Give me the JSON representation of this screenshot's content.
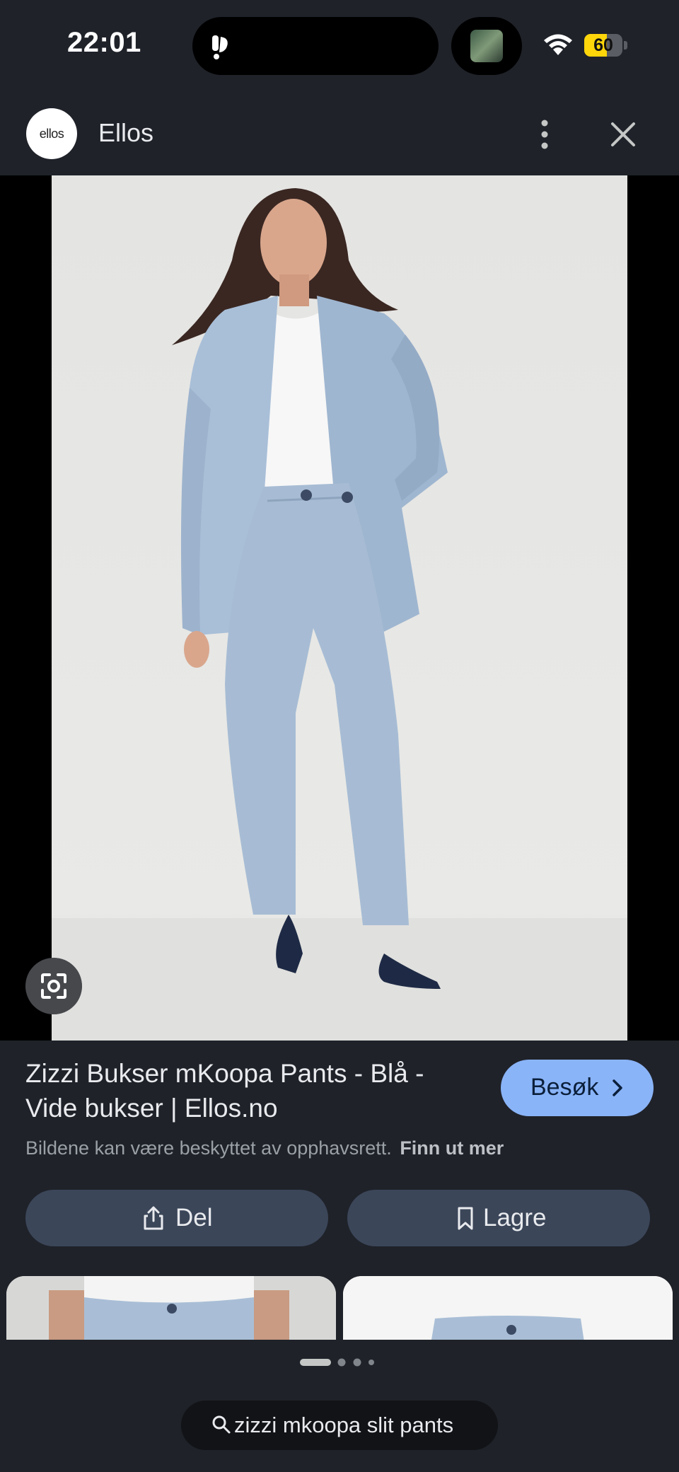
{
  "status_bar": {
    "time": "22:01",
    "battery_level": "60",
    "battery_color": "#ffd60a"
  },
  "header": {
    "logo_text": "ellos",
    "site_name": "Ellos",
    "more_icon": "more-vert-icon",
    "close_icon": "close-icon"
  },
  "image": {
    "description_icon": "lens-icon"
  },
  "result": {
    "title": "Zizzi Bukser mKoopa Pants - Blå - Vide bukser | Ellos.no",
    "visit_label": "Besøk",
    "copyright_text": "Bildene kan være beskyttet av opphavsrett.",
    "learn_more": "Finn ut mer"
  },
  "actions": {
    "share_label": "Del",
    "save_label": "Lagre"
  },
  "bottom": {
    "search_query": "zizzi mkoopa slit pants",
    "page_dots": 4,
    "active_dot": 1
  },
  "colors": {
    "background": "#1f2229",
    "accent": "#8ab4f8",
    "action_button": "#3b4659"
  }
}
